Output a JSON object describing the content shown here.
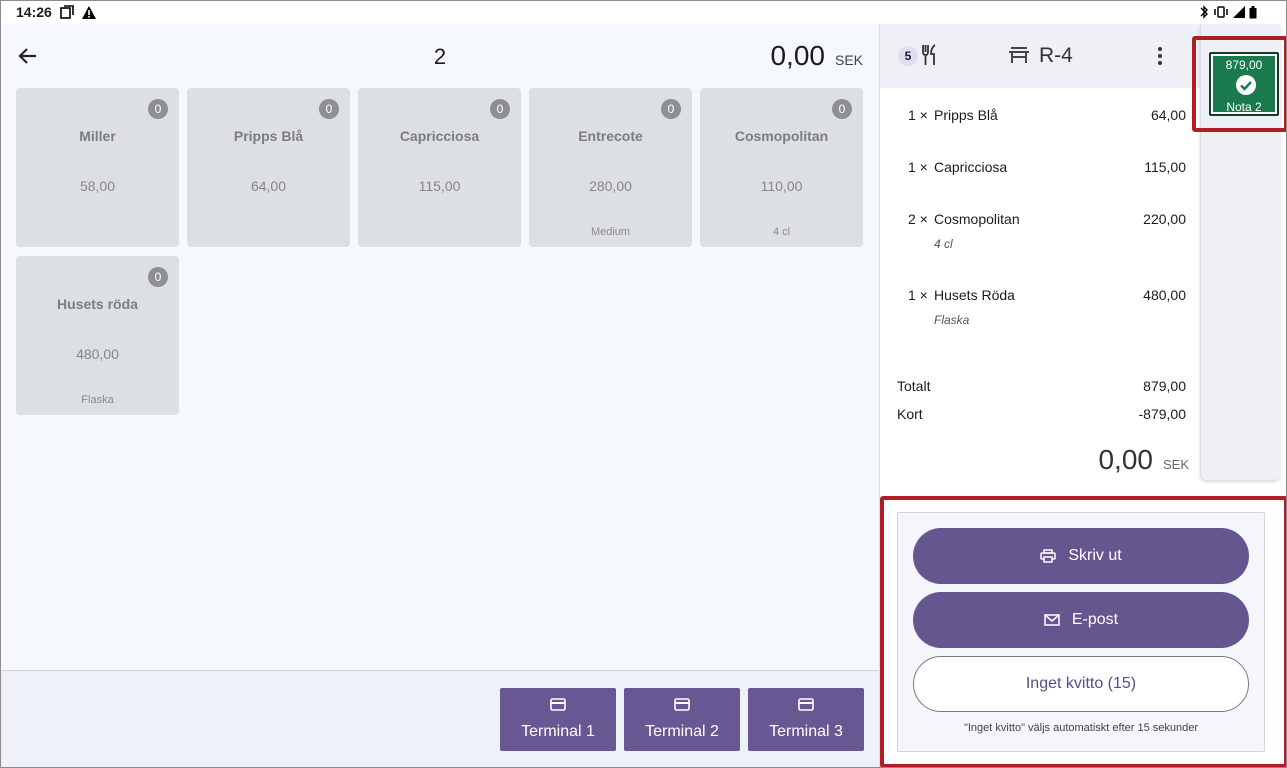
{
  "status_bar": {
    "time": "14:26"
  },
  "header": {
    "order_number": "2",
    "total_amount": "0,00",
    "currency": "SEK"
  },
  "products": [
    {
      "name": "Miller",
      "price": "58,00",
      "count": "0",
      "sub": ""
    },
    {
      "name": "Pripps Blå",
      "price": "64,00",
      "count": "0",
      "sub": ""
    },
    {
      "name": "Capricciosa",
      "price": "115,00",
      "count": "0",
      "sub": ""
    },
    {
      "name": "Entrecote",
      "price": "280,00",
      "count": "0",
      "sub": "Medium"
    },
    {
      "name": "Cosmopolitan",
      "price": "110,00",
      "count": "0",
      "sub": "4 cl"
    },
    {
      "name": "Husets röda",
      "price": "480,00",
      "count": "0",
      "sub": "Flaska"
    }
  ],
  "terminals": [
    {
      "label": "Terminal 1"
    },
    {
      "label": "Terminal 2"
    },
    {
      "label": "Terminal 3"
    }
  ],
  "order_panel": {
    "guest_count": "5",
    "table_name": "R-4",
    "items": [
      {
        "qty": "1 ×",
        "name": "Pripps Blå",
        "price": "64,00",
        "sub": ""
      },
      {
        "qty": "1 ×",
        "name": "Capricciosa",
        "price": "115,00",
        "sub": ""
      },
      {
        "qty": "2 ×",
        "name": "Cosmopolitan",
        "price": "220,00",
        "sub": "4 cl"
      },
      {
        "qty": "1 ×",
        "name": "Husets Röda",
        "price": "480,00",
        "sub": "Flaska"
      }
    ],
    "total_label": "Totalt",
    "total_value": "879,00",
    "card_label": "Kort",
    "card_value": "-879,00",
    "remaining_amount": "0,00",
    "remaining_currency": "SEK"
  },
  "nota": {
    "amount": "879,00",
    "label": "Nota 2"
  },
  "receipt": {
    "print_label": "Skriv ut",
    "email_label": "E-post",
    "no_receipt_label": "Inget kvitto (15)",
    "note": "\"Inget kvitto\" väljs automatiskt efter 15 sekunder"
  },
  "colors": {
    "accent": "#66568f",
    "success": "#1a7a4e",
    "highlight": "#b01f28"
  }
}
